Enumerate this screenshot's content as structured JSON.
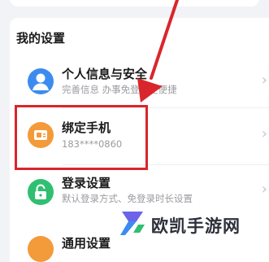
{
  "section": {
    "title": "我的设置"
  },
  "items": [
    {
      "label": "个人信息与安全",
      "subtitle": "完善信息 办事免登录更便捷",
      "icon": "user-avatar-icon"
    },
    {
      "label": "绑定手机",
      "subtitle": "183****0860",
      "icon": "phone-card-icon"
    },
    {
      "label": "登录设置",
      "subtitle": "默认登录方式、免登录时长设置",
      "icon": "lock-icon"
    },
    {
      "label": "通用设置",
      "icon": "settings-icon"
    }
  ],
  "watermark": {
    "text": "欧凯手游网"
  },
  "colors": {
    "highlight": "#d9262c",
    "accent_blue": "#3c8cf0",
    "accent_orange": "#f39a3a",
    "accent_green": "#2fbf71"
  }
}
